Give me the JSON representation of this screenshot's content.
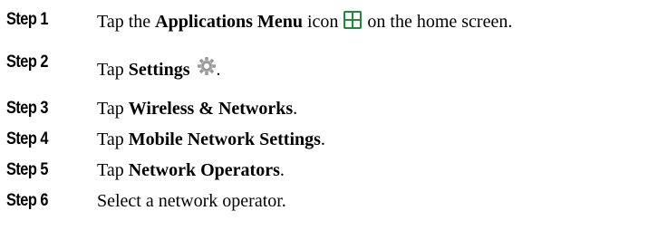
{
  "steps": [
    {
      "label": "Step 1",
      "pre": "Tap the ",
      "bold": "Applications Menu",
      "post": " icon",
      "icon": "applications-menu-icon",
      "after": " on the home screen."
    },
    {
      "label": "Step 2",
      "pre": "Tap ",
      "bold": "Settings",
      "icon": "settings-gear-icon",
      "after": "."
    },
    {
      "label": "Step 3",
      "pre": "Tap ",
      "bold": "Wireless & Networks",
      "post": "."
    },
    {
      "label": "Step 4",
      "pre": "Tap ",
      "bold": "Mobile Network Settings",
      "post": "."
    },
    {
      "label": "Step 5",
      "pre": "Tap ",
      "bold": "Network Operators",
      "post": "."
    },
    {
      "label": "Step 6",
      "pre": "Select a network operator."
    }
  ],
  "colors": {
    "text": "#000000",
    "apps_icon_bg": "#1f8a3a",
    "apps_icon_tiles": "#ffffff",
    "gear_icon": "#9a9a9a"
  }
}
